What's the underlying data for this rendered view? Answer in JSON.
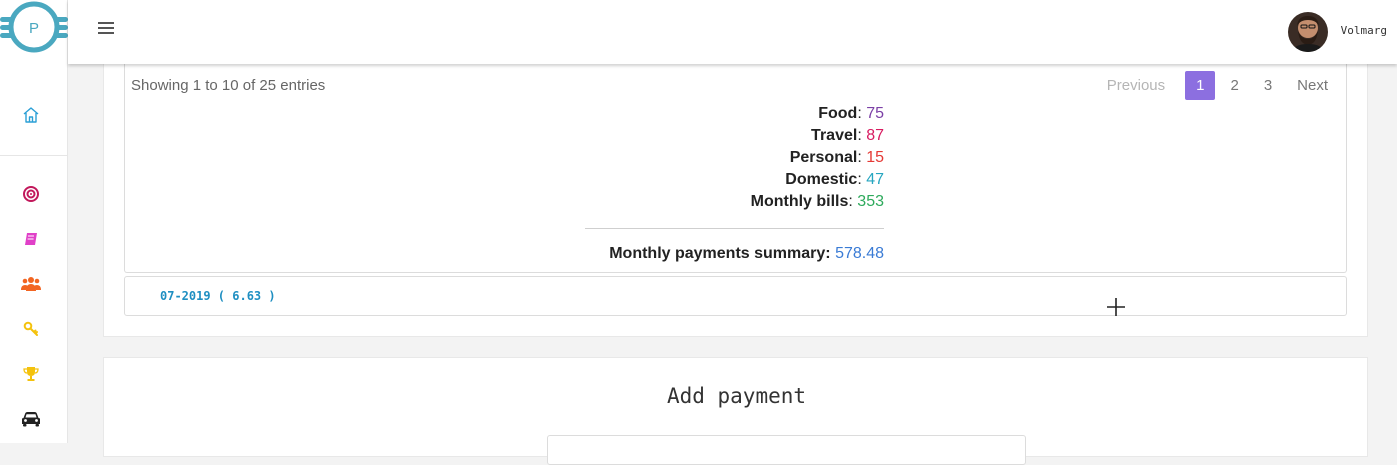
{
  "app": {
    "logo_letter": "P"
  },
  "header": {
    "username": "Volmarg"
  },
  "sidebar": {
    "items": [
      {
        "icon": "home-icon",
        "color": "#2a9fd6"
      },
      {
        "icon": "target-icon",
        "color": "#c2185b"
      },
      {
        "icon": "book-icon",
        "color": "#e040c8"
      },
      {
        "icon": "users-icon",
        "color": "#f26522"
      },
      {
        "icon": "key-icon",
        "color": "#f4c20d"
      },
      {
        "icon": "trophy-icon",
        "color": "#f4c20d"
      },
      {
        "icon": "car-icon",
        "color": "#222222"
      }
    ]
  },
  "table": {
    "showing_text": "Showing 1 to 10 of 25 entries",
    "pagination": {
      "previous": "Previous",
      "pages": [
        "1",
        "2",
        "3"
      ],
      "active": "1",
      "next": "Next"
    }
  },
  "stats": [
    {
      "label": "Food",
      "value": "75",
      "color": "#7b3fa6"
    },
    {
      "label": "Travel",
      "value": "87",
      "color": "#d81b60"
    },
    {
      "label": "Personal",
      "value": "15",
      "color": "#e53935"
    },
    {
      "label": "Domestic",
      "value": "47",
      "color": "#26a6c0"
    },
    {
      "label": "Monthly bills",
      "value": "353",
      "color": "#2eaa5c"
    }
  ],
  "summary": {
    "label": "Monthly payments summary:",
    "value": "578.48",
    "color": "#3a7bd5"
  },
  "month_row": {
    "label": "07-2019 ( 6.63 )"
  },
  "add_payment": {
    "title": "Add payment"
  }
}
